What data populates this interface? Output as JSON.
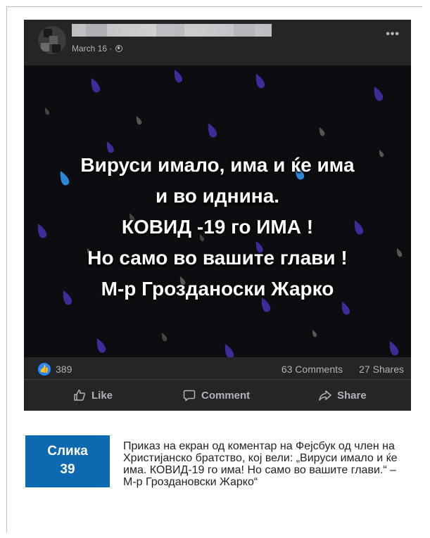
{
  "post": {
    "date": "March 16",
    "meta_separator": "·",
    "image_text_lines": [
      "Вируси имало, има и ќе има",
      "и во иднина.",
      "КОВИД -19 го ИМА !",
      "Но само во вашите глави !",
      "М-р Грозданоски Жарко"
    ],
    "reactions_count": "389",
    "comments_count": "63 Comments",
    "shares_count": "27 Shares",
    "actions": {
      "like": "Like",
      "comment": "Comment",
      "share": "Share"
    },
    "colors": {
      "card_bg": "#242526",
      "image_bg": "#0c0d10",
      "raindrop_purple": "#3f2c9a",
      "raindrop_blue": "#2d86d6",
      "meta_text": "#b0b3b8",
      "like_blue": "#2d88ff"
    },
    "icons": [
      "globe-icon",
      "more-icon",
      "like-reaction-icon",
      "thumbs-up-icon",
      "comment-icon",
      "share-icon"
    ]
  },
  "caption": {
    "label": "Слика",
    "number": "39",
    "text": "Приказ на екран од коментар на Фејсбук од член на Христијанско братство, кој вели: „Вируси имало и ќе има. КОВИД-19 го има! Но само во вашите глави.“ – М-р Гроздановски Жарко“",
    "badge_color": "#0d6ab1"
  }
}
